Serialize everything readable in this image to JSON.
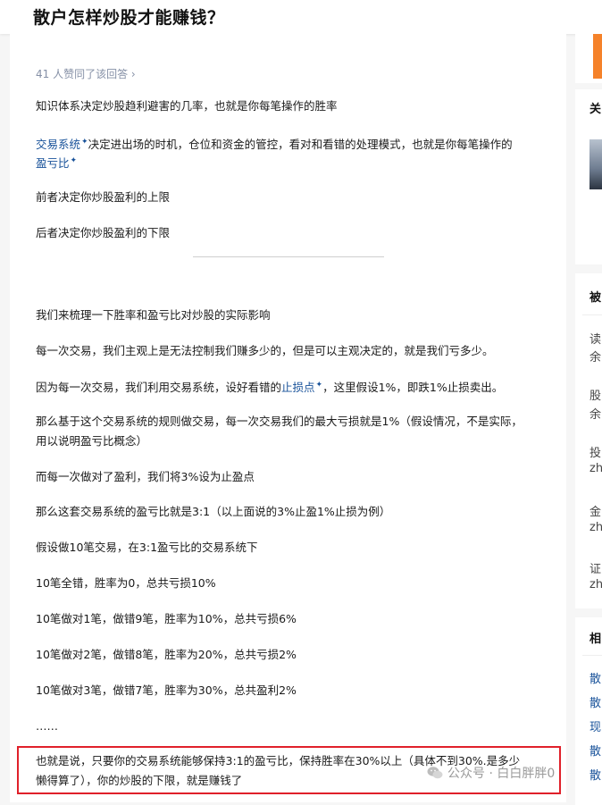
{
  "question": {
    "title": "散户怎样炒股才能赚钱？"
  },
  "answer": {
    "votes_text": "41 人赞同了该回答",
    "votes_arrow": "›",
    "p1": "知识体系决定炒股趋利避害的几率，也就是你每笔操作的胜率",
    "p2_link1": "交易系统",
    "p2_rest": "决定进出场的时机，仓位和资金的管控，看对和看错的处理模式，也就是你每笔操作的",
    "p2_link2": "盈亏比",
    "p3": "前者决定你炒股盈利的上限",
    "p4": "后者决定你炒股盈利的下限",
    "p5": "我们来梳理一下胜率和盈亏比对炒股的实际影响",
    "p6": "每一次交易，我们主观上是无法控制我们赚多少的，但是可以主观决定的，就是我们亏多少。",
    "p7_pre": "因为每一次交易，我们利用交易系统，设好看错的",
    "p7_link": "止损点",
    "p7_post": "，这里假设1%，即跌1%止损卖出。",
    "p8_line1": "那么基于这个交易系统的规则做交易，每一次交易我们的最大亏损就是1%（假设情况，不是实际，",
    "p8_line2": "用以说明盈亏比概念）",
    "p9": "而每一次做对了盈利，我们将3%设为止盈点",
    "p10": "那么这套交易系统的盈亏比就是3:1（以上面说的3%止盈1%止损为例）",
    "p11": "假设做10笔交易，在3:1盈亏比的交易系统下",
    "p12": "10笔全错，胜率为0，总共亏损10%",
    "p13": "10笔做对1笔，做错9笔，胜率为10%，总共亏损6%",
    "p14": "10笔做对2笔，做错8笔，胜率为20%，总共亏损2%",
    "p15": "10笔做对3笔，做错7笔，胜率为30%，总共盈利2%",
    "p16": "……",
    "p17_line1": "也就是说，只要你的交易系统能够保持3:1的盈亏比，保持胜率在30%以上（具体不到30%.是多少",
    "p17_line2": "懒得算了），你的炒股的下限，就是赚钱了"
  },
  "watermark": {
    "text": "公众号 · 白白胖胖0",
    "icon": "wechat-icon"
  },
  "sidebar": {
    "heading1": "关",
    "heading2": "被",
    "items": [
      {
        "l1": "读",
        "l2": "余"
      },
      {
        "l1": "股",
        "l2": "余"
      },
      {
        "l1": "投",
        "l2": "zh"
      },
      {
        "l1": "金",
        "l2": "zh"
      },
      {
        "l1": "证",
        "l2": "zh"
      }
    ],
    "heading3": "相",
    "related": [
      "散",
      "散",
      "现",
      "散",
      "散"
    ]
  },
  "colors": {
    "link": "#175199",
    "highlight_border": "#e0202a",
    "accent_orange": "#f5822a"
  }
}
